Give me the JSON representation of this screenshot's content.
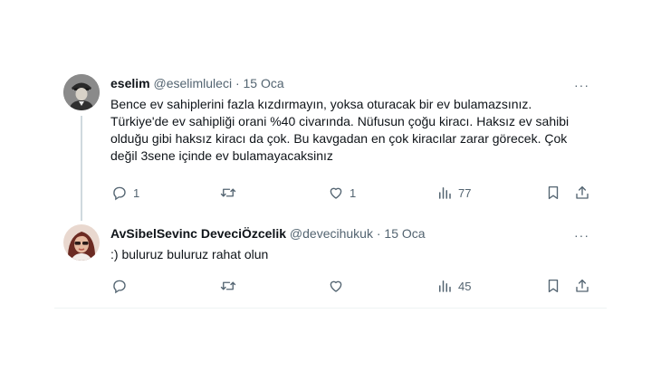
{
  "tweets": [
    {
      "display_name": "eselim",
      "handle": "@eselimluleci",
      "separator": "·",
      "date": "15 Oca",
      "more_label": "···",
      "text": "Bence ev sahiplerini fazla kızdırmayın, yoksa oturacak bir ev bulamazsınız. Türkiye'de ev sahipliği orani %40 civarında. Nüfusun çoğu kiracı. Haksız ev sahibi olduğu gibi haksız kiracı da çok. Bu kavgadan en çok kiracılar zarar görecek. Çok değil 3sene içinde ev bulamayacaksinız",
      "actions": {
        "replies": "1",
        "retweets": "",
        "likes": "1",
        "views": "77"
      }
    },
    {
      "display_name": "AvSibelSevinc DeveciÖzcelik",
      "handle": "@devecihukuk",
      "separator": "·",
      "date": "15 Oca",
      "more_label": "···",
      "text": ":) buluruz buluruz rahat olun",
      "actions": {
        "replies": "",
        "retweets": "",
        "likes": "",
        "views": "45"
      }
    }
  ],
  "icons": {
    "reply": "speech-bubble-icon",
    "retweet": "retweet-arrows-icon",
    "like": "heart-icon",
    "views": "bar-chart-icon",
    "bookmark": "bookmark-icon",
    "share": "share-upload-icon"
  },
  "colors": {
    "text": "#0f1419",
    "secondary": "#536471",
    "thread_line": "#cfd9de",
    "divider": "#eff3f4"
  }
}
